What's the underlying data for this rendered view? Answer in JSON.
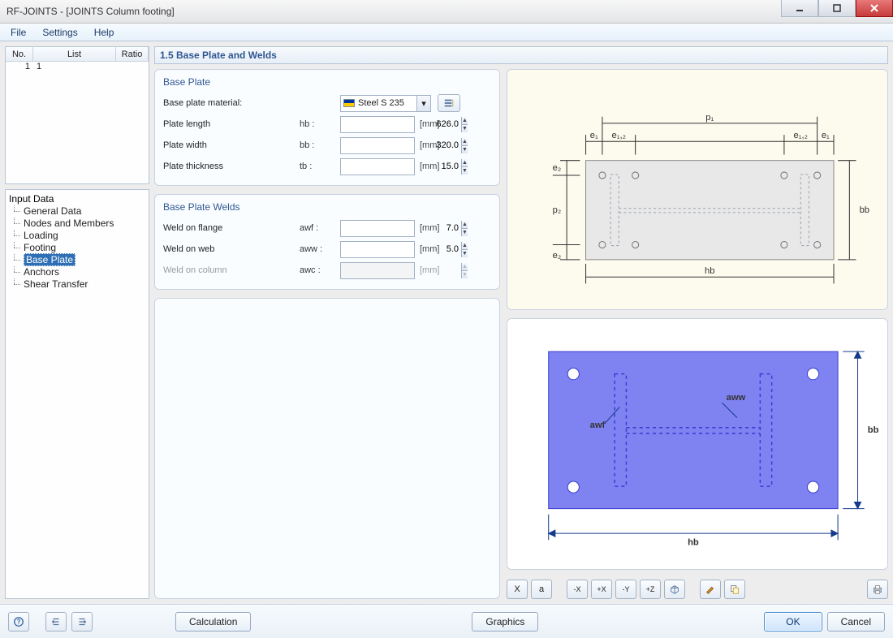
{
  "window": {
    "title": "RF-JOINTS - [JOINTS Column footing]"
  },
  "menu": {
    "file": "File",
    "settings": "Settings",
    "help": "Help"
  },
  "list": {
    "hdr_no": "No.",
    "hdr_list": "List",
    "hdr_ratio": "Ratio",
    "rows": [
      {
        "no": "1",
        "list": "1"
      }
    ]
  },
  "tree": {
    "root": "Input Data",
    "items": [
      "General Data",
      "Nodes and Members",
      "Loading",
      "Footing",
      "Base Plate",
      "Anchors",
      "Shear Transfer"
    ],
    "selected": 4
  },
  "section": {
    "title": "1.5 Base Plate and Welds"
  },
  "groups": {
    "plate": {
      "title": "Base Plate",
      "material": {
        "label": "Base plate material:",
        "value": "Steel S 235"
      },
      "length": {
        "label": "Plate length",
        "sym": "hb :",
        "value": "626.0",
        "unit": "[mm]"
      },
      "width": {
        "label": "Plate width",
        "sym": "bb :",
        "value": "320.0",
        "unit": "[mm]"
      },
      "thick": {
        "label": "Plate thickness",
        "sym": "tb :",
        "value": "15.0",
        "unit": "[mm]"
      }
    },
    "welds": {
      "title": "Base Plate Welds",
      "flange": {
        "label": "Weld on flange",
        "sym": "awf :",
        "value": "7.0",
        "unit": "[mm]"
      },
      "web": {
        "label": "Weld on web",
        "sym": "aww :",
        "value": "5.0",
        "unit": "[mm]"
      },
      "column": {
        "label": "Weld on column",
        "sym": "awc :",
        "value": "",
        "unit": "[mm]"
      }
    }
  },
  "diagram_top": {
    "p1": "p₁",
    "e1": "e₁",
    "e12": "e₁,₂",
    "e2": "e₂",
    "p2": "p₂",
    "hb": "hb",
    "bb": "bb"
  },
  "diagram_bottom": {
    "awf": "awf",
    "aww": "aww",
    "hb": "hb",
    "bb": "bb"
  },
  "view_toolbar": {
    "b1": "X",
    "b2": "a",
    "b3": "-X",
    "b4": "+X",
    "b5": "-Y",
    "b6": "+Z",
    "b7": "Iso",
    "b8": "Edit",
    "b9": "Copy",
    "b10": "Print"
  },
  "footer": {
    "calc": "Calculation",
    "graphics": "Graphics",
    "ok": "OK",
    "cancel": "Cancel"
  }
}
